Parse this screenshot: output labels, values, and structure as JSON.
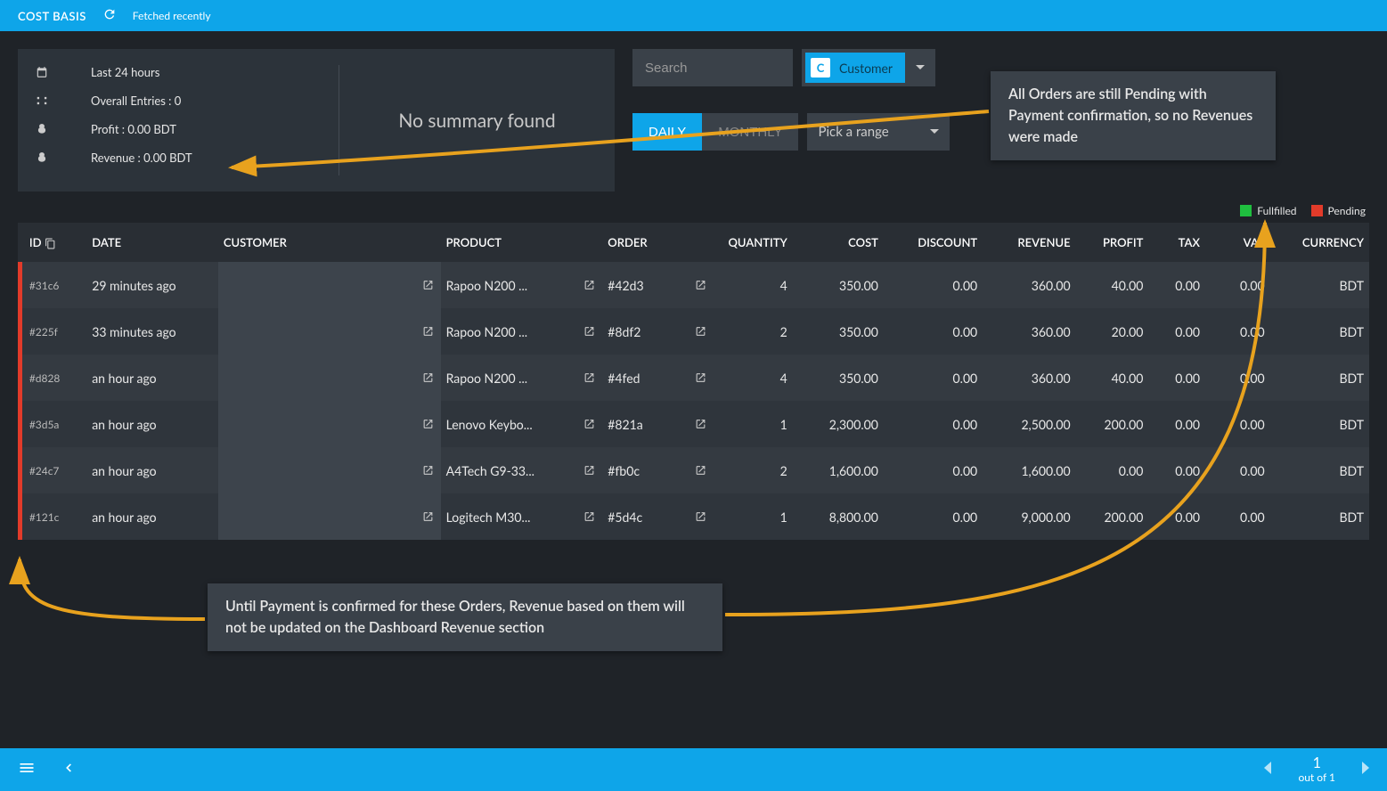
{
  "header": {
    "title": "COST BASIS",
    "fetched": "Fetched recently"
  },
  "summary": {
    "period": "Last 24 hours",
    "entries": "Overall Entries : 0",
    "profit": "Profit : 0.00 BDT",
    "revenue": "Revenue : 0.00 BDT",
    "no_summary": "No summary found"
  },
  "filters": {
    "search_placeholder": "Search",
    "chip_badge": "C",
    "chip_label": "Customer",
    "tab_daily": "DAILY",
    "tab_monthly": "MONTHLY",
    "range_placeholder": "Pick a range"
  },
  "legend": {
    "fulfilled": "Fullfilled",
    "pending": "Pending"
  },
  "columns": {
    "id": "ID",
    "date": "DATE",
    "customer": "CUSTOMER",
    "product": "PRODUCT",
    "order": "ORDER",
    "quantity": "QUANTITY",
    "cost": "COST",
    "discount": "DISCOUNT",
    "revenue": "REVENUE",
    "profit": "PROFIT",
    "tax": "TAX",
    "vat": "VAT",
    "currency": "CURRENCY"
  },
  "rows": [
    {
      "id": "#31c6",
      "date": "29 minutes ago",
      "product": "Rapoo N200 ...",
      "order": "#42d3",
      "quantity": "4",
      "cost": "350.00",
      "discount": "0.00",
      "revenue": "360.00",
      "profit": "40.00",
      "tax": "0.00",
      "vat": "0.00",
      "currency": "BDT"
    },
    {
      "id": "#225f",
      "date": "33 minutes ago",
      "product": "Rapoo N200 ...",
      "order": "#8df2",
      "quantity": "2",
      "cost": "350.00",
      "discount": "0.00",
      "revenue": "360.00",
      "profit": "20.00",
      "tax": "0.00",
      "vat": "0.00",
      "currency": "BDT"
    },
    {
      "id": "#d828",
      "date": "an hour ago",
      "product": "Rapoo N200 ...",
      "order": "#4fed",
      "quantity": "4",
      "cost": "350.00",
      "discount": "0.00",
      "revenue": "360.00",
      "profit": "40.00",
      "tax": "0.00",
      "vat": "0.00",
      "currency": "BDT"
    },
    {
      "id": "#3d5a",
      "date": "an hour ago",
      "product": "Lenovo Keybo...",
      "order": "#821a",
      "quantity": "1",
      "cost": "2,300.00",
      "discount": "0.00",
      "revenue": "2,500.00",
      "profit": "200.00",
      "tax": "0.00",
      "vat": "0.00",
      "currency": "BDT"
    },
    {
      "id": "#24c7",
      "date": "an hour ago",
      "product": "A4Tech G9-33...",
      "order": "#fb0c",
      "quantity": "2",
      "cost": "1,600.00",
      "discount": "0.00",
      "revenue": "1,600.00",
      "profit": "0.00",
      "tax": "0.00",
      "vat": "0.00",
      "currency": "BDT"
    },
    {
      "id": "#121c",
      "date": "an hour ago",
      "product": "Logitech M30...",
      "order": "#5d4c",
      "quantity": "1",
      "cost": "8,800.00",
      "discount": "0.00",
      "revenue": "9,000.00",
      "profit": "200.00",
      "tax": "0.00",
      "vat": "0.00",
      "currency": "BDT"
    }
  ],
  "pager": {
    "page": "1",
    "total": "out of 1"
  },
  "annotations": {
    "a1": "All Orders are still Pending with Payment confirmation, so no Revenues were made",
    "a2": "Until Payment is confirmed for these Orders, Revenue based on them will not be updated on the Dashboard Revenue section"
  },
  "colors": {
    "accent": "#0ea5e9",
    "pending": "#e23b2a",
    "fulfilled": "#1fbf3f",
    "arrow": "#e8a21e"
  }
}
